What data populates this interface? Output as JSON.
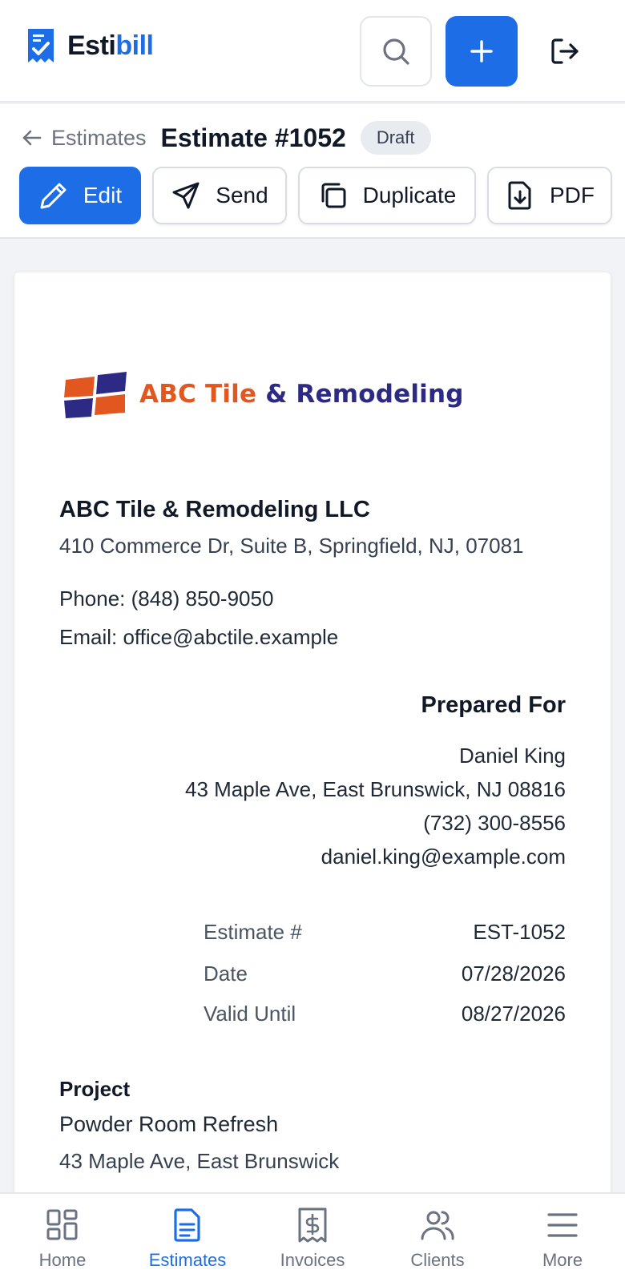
{
  "app": {
    "name_part1": "Esti",
    "name_part2": "bill",
    "brand_color": "#1d6ee6"
  },
  "header": {
    "icons": [
      "receipt-check-icon",
      "search-icon",
      "plus-icon",
      "logout-icon"
    ]
  },
  "breadcrumb": {
    "back_label": "Estimates",
    "title": "Estimate #1052",
    "status": "Draft"
  },
  "actions": {
    "edit": "Edit",
    "send": "Send",
    "duplicate": "Duplicate",
    "pdf": "PDF"
  },
  "document": {
    "logo": {
      "text_part1": "ABC Tile",
      "text_part2": "& Remodeling",
      "color_orange": "#e1571f",
      "color_navy": "#2d2a86"
    },
    "company": {
      "name": "ABC Tile & Remodeling LLC",
      "address": "410 Commerce Dr, Suite B, Springfield, NJ, 07081",
      "phone": "Phone: (848) 850-9050",
      "email": "Email: office@abctile.example"
    },
    "prepared_for": {
      "heading": "Prepared For",
      "name": "Daniel King",
      "address": "43 Maple Ave, East Brunswick, NJ 08816",
      "phone": "(732) 300-8556",
      "email": "daniel.king@example.com"
    },
    "meta": [
      {
        "label": "Estimate #",
        "value": "EST-1052"
      },
      {
        "label": "Date",
        "value": "07/28/2026"
      },
      {
        "label": "Valid Until",
        "value": "08/27/2026"
      }
    ],
    "project": {
      "heading": "Project",
      "name": "Powder Room Refresh",
      "address": "43 Maple Ave, East Brunswick"
    }
  },
  "bottom_nav": {
    "items": [
      {
        "label": "Home",
        "icon": "grid-icon",
        "active": false
      },
      {
        "label": "Estimates",
        "icon": "document-icon",
        "active": true
      },
      {
        "label": "Invoices",
        "icon": "receipt-dollar-icon",
        "active": false
      },
      {
        "label": "Clients",
        "icon": "users-icon",
        "active": false
      },
      {
        "label": "More",
        "icon": "menu-icon",
        "active": false
      }
    ]
  }
}
